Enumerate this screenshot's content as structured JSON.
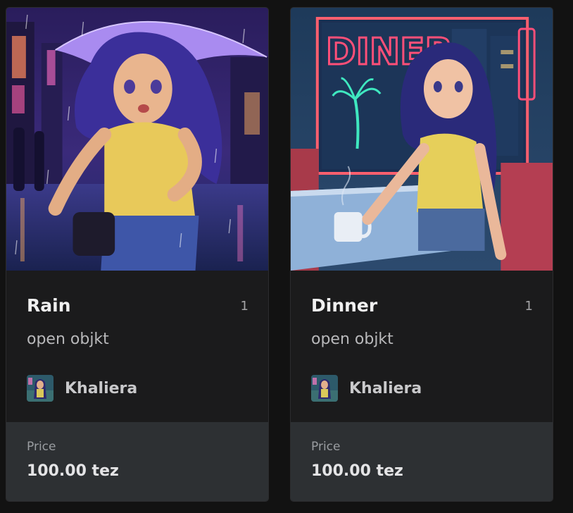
{
  "cards": [
    {
      "title": "Rain",
      "edition_count": "1",
      "subtitle": "open objkt",
      "creator": {
        "name": "Khaliera",
        "avatar_icon": "artist-avatar-icon"
      },
      "price": {
        "label": "Price",
        "value": "100.00 tez"
      }
    },
    {
      "title": "Dinner",
      "edition_count": "1",
      "subtitle": "open objkt",
      "creator": {
        "name": "Khaliera",
        "avatar_icon": "artist-avatar-icon"
      },
      "price": {
        "label": "Price",
        "value": "100.00 tez"
      }
    }
  ],
  "colors": {
    "background": "#121212",
    "card": "#1b1b1c",
    "price_panel": "#2d3033",
    "title": "#f0f0f0"
  }
}
